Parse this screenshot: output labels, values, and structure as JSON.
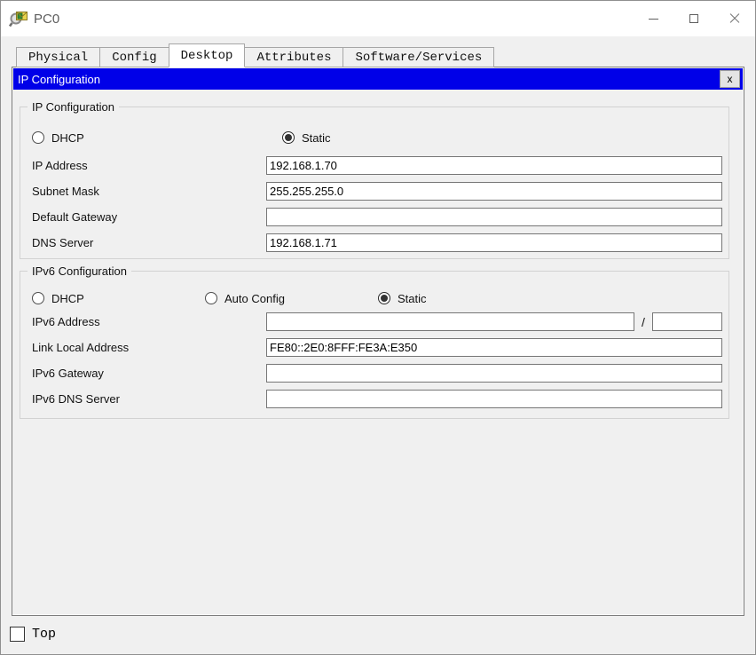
{
  "window": {
    "title": "PC0"
  },
  "icons": {
    "app_icon": "packet-tracer-magnifier-envelope",
    "minimize_icon": "minimize-dash",
    "maximize_icon": "maximize-square",
    "close_icon": "close-x"
  },
  "tabs": [
    {
      "label": "Physical",
      "active": false
    },
    {
      "label": "Config",
      "active": false
    },
    {
      "label": "Desktop",
      "active": true
    },
    {
      "label": "Attributes",
      "active": false
    },
    {
      "label": "Software/Services",
      "active": false
    }
  ],
  "dialog": {
    "title": "IP Configuration",
    "close_label": "x"
  },
  "ip_config": {
    "legend": "IP Configuration",
    "radios": [
      {
        "label": "DHCP",
        "checked": false
      },
      {
        "label": "Static",
        "checked": true
      }
    ],
    "fields": [
      {
        "label": "IP Address",
        "value": "192.168.1.70"
      },
      {
        "label": "Subnet Mask",
        "value": "255.255.255.0"
      },
      {
        "label": "Default Gateway",
        "value": ""
      },
      {
        "label": "DNS Server",
        "value": "192.168.1.71"
      }
    ]
  },
  "ipv6_config": {
    "legend": "IPv6 Configuration",
    "radios": [
      {
        "label": "DHCP",
        "checked": false
      },
      {
        "label": "Auto Config",
        "checked": false
      },
      {
        "label": "Static",
        "checked": true
      }
    ],
    "address_row": {
      "label": "IPv6 Address",
      "value": "",
      "separator": "/",
      "prefix_value": ""
    },
    "fields": [
      {
        "label": "Link Local Address",
        "value": "FE80::2E0:8FFF:FE3A:E350"
      },
      {
        "label": "IPv6 Gateway",
        "value": ""
      },
      {
        "label": "IPv6 DNS Server",
        "value": ""
      }
    ]
  },
  "footer": {
    "checkbox_label": "Top",
    "checkbox_checked": false
  },
  "colors": {
    "dialog_titlebar": "#0000e8",
    "panel_background": "#f0f0f0",
    "titlebar_background": "#ffffff",
    "input_border": "#767676"
  }
}
